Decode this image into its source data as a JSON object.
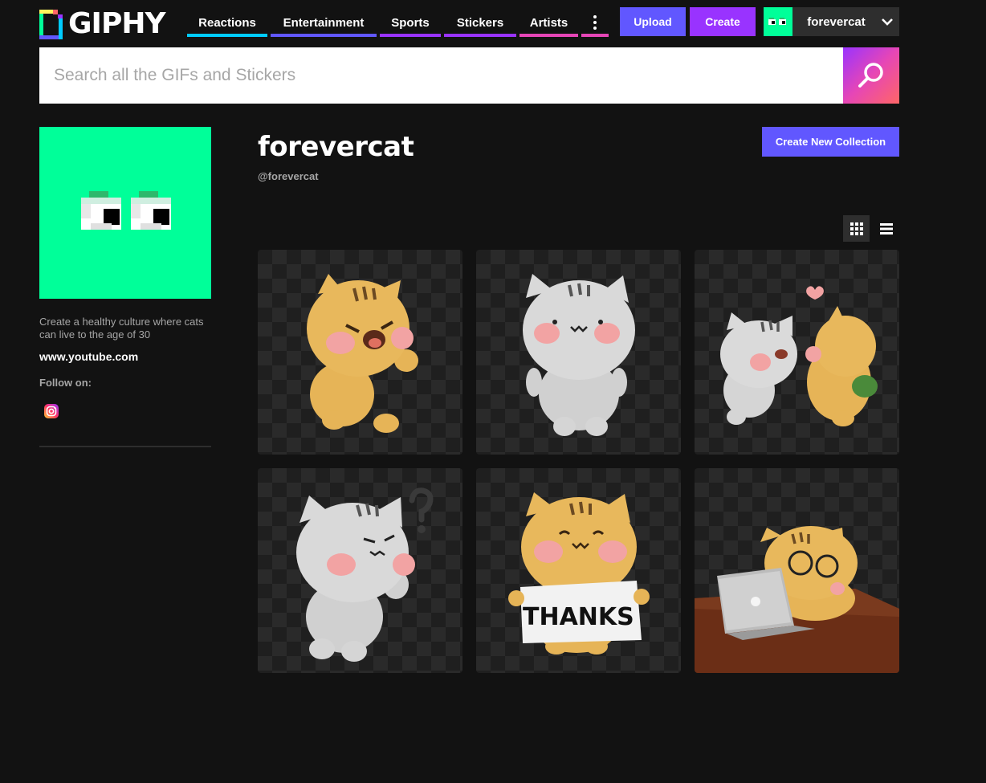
{
  "header": {
    "logo_text": "GIPHY",
    "nav": [
      {
        "label": "Reactions",
        "underline": "#00ccff"
      },
      {
        "label": "Entertainment",
        "underline": "#6157ff"
      },
      {
        "label": "Sports",
        "underline": "#9933ff"
      },
      {
        "label": "Stickers",
        "underline": "#9933ff"
      },
      {
        "label": "Artists",
        "underline": "#e646b6"
      }
    ],
    "more_icon": "vertical-dots-icon",
    "upload_label": "Upload",
    "create_label": "Create",
    "user": {
      "username": "forevercat",
      "chevron_icon": "chevron-down-icon"
    }
  },
  "search": {
    "placeholder": "Search all the GIFs and Stickers",
    "value": "",
    "button_icon": "search-icon"
  },
  "sidebar": {
    "avatar_icon": "pixel-eyes-avatar",
    "avatar_color": "#00ff99",
    "bio": "Create a healthy culture where cats can live to the age of 30",
    "website": "www.youtube.com",
    "follow_label": "Follow on:",
    "social": [
      {
        "icon": "instagram-icon"
      }
    ]
  },
  "channel": {
    "name": "forevercat",
    "handle": "@forevercat",
    "create_collection_label": "Create New Collection",
    "view_modes": [
      {
        "icon": "grid-view-icon",
        "active": true
      },
      {
        "icon": "list-view-icon",
        "active": false
      }
    ]
  },
  "grid": {
    "items": [
      {
        "description": "orange-cat-angry-sticker"
      },
      {
        "description": "gray-cat-standing-sticker"
      },
      {
        "description": "gray-and-orange-cat-kiss-sticker"
      },
      {
        "description": "gray-cat-confused-sticker"
      },
      {
        "description": "orange-cat-thanks-sign-sticker",
        "sign_text": "THANKS"
      },
      {
        "description": "orange-cat-laptop-gif"
      }
    ]
  },
  "colors": {
    "background": "#121212",
    "accent_purple": "#6157ff",
    "accent_violet": "#9933ff",
    "accent_green": "#00ff99",
    "accent_pink": "#e646b6"
  }
}
